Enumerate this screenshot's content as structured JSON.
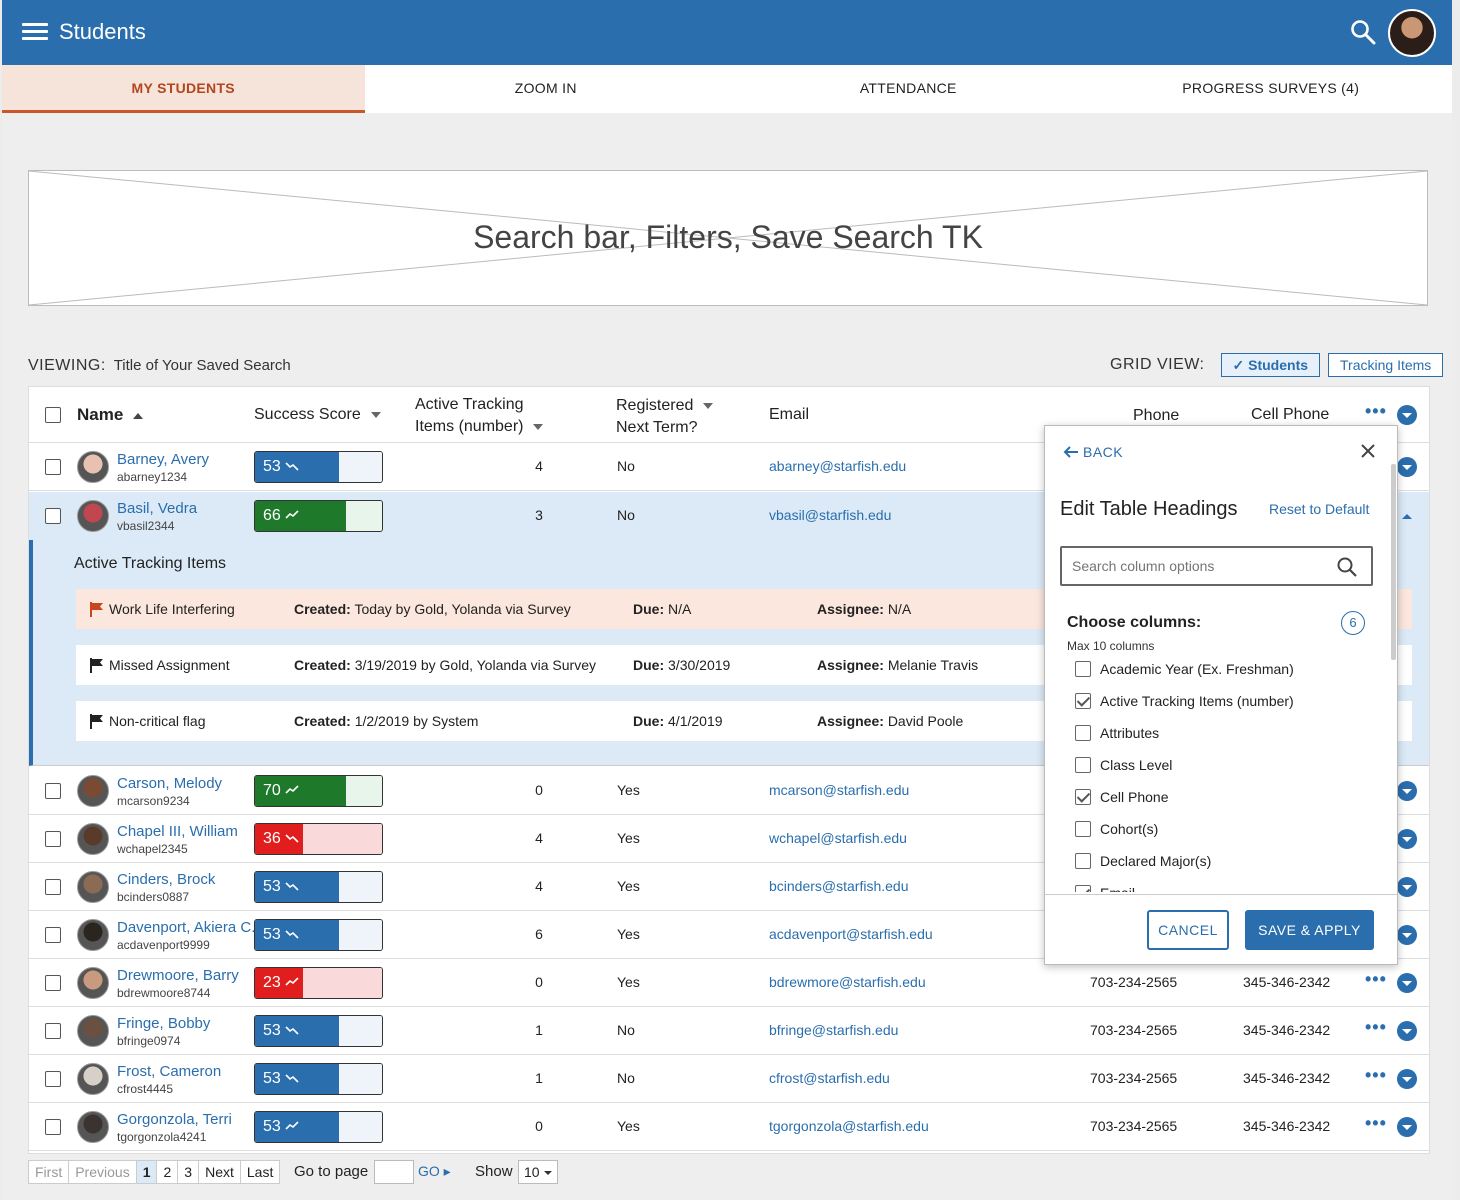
{
  "app": {
    "title": "Students"
  },
  "tabs": [
    {
      "label": "MY STUDENTS",
      "active": true
    },
    {
      "label": "ZOOM IN",
      "active": false
    },
    {
      "label": "ATTENDANCE",
      "active": false
    },
    {
      "label": "PROGRESS SURVEYS (4)",
      "active": false
    }
  ],
  "placeholder": {
    "text": "Search bar, Filters, Save Search TK"
  },
  "viewing": {
    "label": "VIEWING:",
    "value": "Title of Your Saved Search"
  },
  "grid_view": {
    "label": "GRID VIEW:",
    "students": "Students",
    "tracking": "Tracking Items"
  },
  "columns": {
    "name": "Name",
    "success": "Success Score",
    "tracking_1": "Active Tracking",
    "tracking_2": "Items (number)",
    "registered_1": "Registered",
    "registered_2": "Next Term?",
    "email": "Email",
    "phone": "Phone",
    "cell": "Cell Phone"
  },
  "colors": {
    "primary": "#2a6ead",
    "green": "#1e7a2a",
    "red": "#e01e1e",
    "blue": "#2a6ead"
  },
  "rows": [
    {
      "name": "Barney, Avery",
      "username": "abarney1234",
      "score": 53,
      "level": "blue",
      "trend": "down",
      "tracking": 4,
      "registered": "No",
      "email": "abarney@starfish.edu",
      "phone": "",
      "cell": ""
    },
    {
      "name": "Basil, Vedra",
      "username": "vbasil2344",
      "score": 66,
      "level": "green",
      "trend": "up",
      "tracking": 3,
      "registered": "No",
      "email": "vbasil@starfish.edu",
      "phone": "",
      "cell": ""
    },
    {
      "name": "Carson, Melody",
      "username": "mcarson9234",
      "score": 70,
      "level": "green",
      "trend": "up",
      "tracking": 0,
      "registered": "Yes",
      "email": "mcarson@starfish.edu",
      "phone": "",
      "cell": ""
    },
    {
      "name": "Chapel III, William",
      "username": "wchapel2345",
      "score": 36,
      "level": "red",
      "trend": "down",
      "tracking": 4,
      "registered": "Yes",
      "email": "wchapel@starfish.edu",
      "phone": "",
      "cell": ""
    },
    {
      "name": "Cinders, Brock",
      "username": "bcinders0887",
      "score": 53,
      "level": "blue",
      "trend": "down",
      "tracking": 4,
      "registered": "Yes",
      "email": "bcinders@starfish.edu",
      "phone": "",
      "cell": ""
    },
    {
      "name": "Davenport, Akiera C.",
      "username": "acdavenport9999",
      "score": 53,
      "level": "blue",
      "trend": "down",
      "tracking": 6,
      "registered": "Yes",
      "email": "acdavenport@starfish.edu",
      "phone": "",
      "cell": ""
    },
    {
      "name": "Drewmoore, Barry",
      "username": "bdrewmoore8744",
      "score": 23,
      "level": "red",
      "trend": "up",
      "tracking": 0,
      "registered": "Yes",
      "email": "bdrewmore@starfish.edu",
      "phone": "703-234-2565",
      "cell": "345-346-2342"
    },
    {
      "name": "Fringe, Bobby",
      "username": "bfringe0974",
      "score": 53,
      "level": "blue",
      "trend": "down",
      "tracking": 1,
      "registered": "No",
      "email": "bfringe@starfish.edu",
      "phone": "703-234-2565",
      "cell": "345-346-2342"
    },
    {
      "name": "Frost, Cameron",
      "username": "cfrost4445",
      "score": 53,
      "level": "blue",
      "trend": "down",
      "tracking": 1,
      "registered": "No",
      "email": "cfrost@starfish.edu",
      "phone": "703-234-2565",
      "cell": "345-346-2342"
    },
    {
      "name": "Gorgonzola, Terri",
      "username": "tgorgonzola4241",
      "score": 53,
      "level": "blue",
      "trend": "up",
      "tracking": 0,
      "registered": "Yes",
      "email": "tgorgonzola@starfish.edu",
      "phone": "703-234-2565",
      "cell": "345-346-2342"
    }
  ],
  "expanded": {
    "title": "Active Tracking Items",
    "items": [
      {
        "flag": "#c8461d",
        "name": "Work Life Interfering",
        "created_label": "Created:",
        "created": "Today by Gold, Yolanda via Survey",
        "due_label": "Due:",
        "due": "N/A",
        "assignee_label": "Assignee:",
        "assignee": "N/A",
        "highlight": true
      },
      {
        "flag": "#222",
        "name": "Missed Assignment",
        "created_label": "Created:",
        "created": "3/19/2019 by Gold, Yolanda via Survey",
        "due_label": "Due:",
        "due": "3/30/2019",
        "assignee_label": "Assignee:",
        "assignee": "Melanie Travis",
        "highlight": false
      },
      {
        "flag": "#222",
        "name": "Non-critical flag",
        "created_label": "Created:",
        "created": "1/2/2019 by System",
        "due_label": "Due:",
        "due": "4/1/2019",
        "assignee_label": "Assignee:",
        "assignee": "David Poole",
        "highlight": false
      }
    ]
  },
  "modal": {
    "back": "BACK",
    "title": "Edit Table Headings",
    "reset": "Reset to Default",
    "search_placeholder": "Search column options",
    "choose": "Choose columns:",
    "max": "Max 10 columns",
    "count": "6",
    "options": [
      {
        "label": "Academic Year (Ex. Freshman)",
        "checked": false
      },
      {
        "label": "Active Tracking Items (number)",
        "checked": true
      },
      {
        "label": "Attributes",
        "checked": false
      },
      {
        "label": "Class Level",
        "checked": false
      },
      {
        "label": "Cell Phone",
        "checked": true
      },
      {
        "label": "Cohort(s)",
        "checked": false
      },
      {
        "label": "Declared Major(s)",
        "checked": false
      },
      {
        "label": "Email",
        "checked": true
      }
    ],
    "cancel": "CANCEL",
    "save": "SAVE & APPLY"
  },
  "pagination": {
    "first": "First",
    "previous": "Previous",
    "pages": [
      "1",
      "2",
      "3"
    ],
    "current": "1",
    "next": "Next",
    "last": "Last",
    "goto_label": "Go to page",
    "go": "GO",
    "show_label": "Show",
    "show_value": "10"
  }
}
